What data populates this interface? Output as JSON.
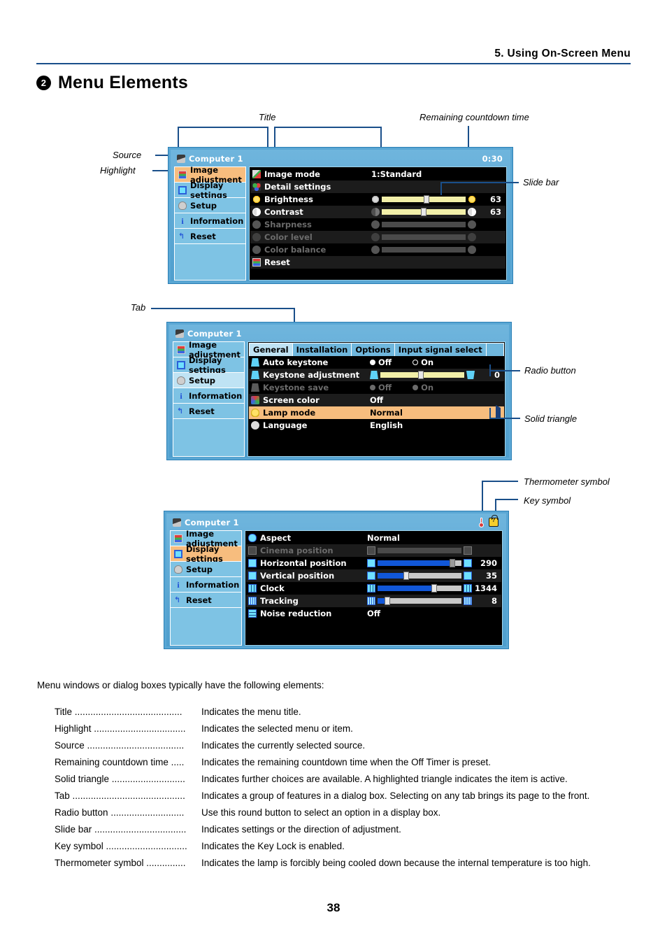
{
  "header": {
    "chapter": "5. Using On-Screen Menu",
    "section_number": "2",
    "section_title": "Menu Elements"
  },
  "callouts": {
    "title": "Title",
    "remaining": "Remaining countdown time",
    "source": "Source",
    "highlight": "Highlight",
    "slide_bar": "Slide bar",
    "tab": "Tab",
    "radio_button": "Radio button",
    "solid_triangle": "Solid triangle",
    "thermometer": "Thermometer symbol",
    "key_symbol": "Key symbol"
  },
  "osd_common": {
    "source_title": "Computer 1",
    "sidebar": [
      {
        "label": "Image adjustment",
        "icon": "grid-icon"
      },
      {
        "label": "Display settings",
        "icon": "screen-icon"
      },
      {
        "label": "Setup",
        "icon": "setup-icon"
      },
      {
        "label": "Information",
        "icon": "info-icon"
      },
      {
        "label": "Reset",
        "icon": "reset-icon"
      }
    ]
  },
  "osd1": {
    "title": "Computer 1",
    "countdown": "0:30",
    "selected_sidebar": 0,
    "rows": [
      {
        "label": "Image mode",
        "value": "1:Standard",
        "icon": "image-mode-icon",
        "type": "value",
        "dim": false
      },
      {
        "label": "Detail settings",
        "value": "",
        "icon": "detail-settings-icon",
        "type": "value",
        "dim": false
      },
      {
        "label": "Brightness",
        "value": "63",
        "icon": "brightness-icon",
        "type": "slider",
        "dim": false,
        "bar": "yellow",
        "pos": 50
      },
      {
        "label": "Contrast",
        "value": "63",
        "icon": "contrast-icon",
        "type": "slider",
        "dim": false,
        "bar": "yellow",
        "pos": 48
      },
      {
        "label": "Sharpness",
        "value": "",
        "icon": "sharpness-icon",
        "type": "slider",
        "dim": true,
        "bar": "gray",
        "pos": 0
      },
      {
        "label": "Color level",
        "value": "",
        "icon": "color-level-icon",
        "type": "slider",
        "dim": true,
        "bar": "gray",
        "pos": 0
      },
      {
        "label": "Color balance",
        "value": "",
        "icon": "color-balance-icon",
        "type": "slider",
        "dim": true,
        "bar": "gray",
        "pos": 0
      },
      {
        "label": "Reset",
        "value": "",
        "icon": "reset-multi-icon",
        "type": "value",
        "dim": false
      }
    ]
  },
  "osd2": {
    "title": "Computer 1",
    "selected_sidebar": 2,
    "tabs": [
      {
        "label": "General",
        "active": true
      },
      {
        "label": "Installation",
        "active": false
      },
      {
        "label": "Options",
        "active": false
      },
      {
        "label": "Input signal select",
        "active": false
      }
    ],
    "rows": [
      {
        "label": "Auto keystone",
        "icon": "auto-keystone-icon",
        "type": "radio",
        "dim": false,
        "options": [
          {
            "label": "Off",
            "selected": true
          },
          {
            "label": "On",
            "selected": false
          }
        ]
      },
      {
        "label": "Keystone adjustment",
        "icon": "keystone-icon",
        "type": "slider",
        "dim": false,
        "bar": "yellow",
        "pos": 45,
        "value": "0"
      },
      {
        "label": "Keystone save",
        "icon": "keystone-save-icon",
        "type": "radio",
        "dim": true,
        "options": [
          {
            "label": "Off",
            "selected": true
          },
          {
            "label": "On",
            "selected": false
          }
        ]
      },
      {
        "label": "Screen color",
        "icon": "screen-color-icon",
        "type": "value",
        "dim": false,
        "value": "Off"
      },
      {
        "label": "Lamp mode",
        "icon": "lamp-icon",
        "type": "value",
        "dim": false,
        "value": "Normal",
        "highlight": true,
        "triangle": true
      },
      {
        "label": "Language",
        "icon": "language-icon",
        "type": "value",
        "dim": false,
        "value": "English"
      }
    ]
  },
  "osd3": {
    "title": "Computer 1",
    "selected_sidebar": 1,
    "status_icons": [
      "thermometer-icon",
      "key-lock-icon"
    ],
    "rows": [
      {
        "label": "Aspect",
        "icon": "aspect-icon",
        "type": "value",
        "dim": false,
        "value": "Normal"
      },
      {
        "label": "Cinema position",
        "icon": "cinema-position-icon",
        "type": "slider",
        "dim": true,
        "bar": "gray",
        "pos": 0,
        "value": ""
      },
      {
        "label": "Horizontal position",
        "icon": "horizontal-position-icon",
        "type": "slider",
        "dim": false,
        "bar": "blue",
        "pos": 88,
        "value": "290"
      },
      {
        "label": "Vertical position",
        "icon": "vertical-position-icon",
        "type": "slider",
        "dim": false,
        "bar": "blue",
        "pos": 33,
        "value": "35"
      },
      {
        "label": "Clock",
        "icon": "clock-icon",
        "type": "slider",
        "dim": false,
        "bar": "blue",
        "pos": 66,
        "value": "1344"
      },
      {
        "label": "Tracking",
        "icon": "tracking-icon",
        "type": "slider",
        "dim": false,
        "bar": "blue",
        "pos": 9,
        "value": "8"
      },
      {
        "label": "Noise reduction",
        "icon": "noise-reduction-icon",
        "type": "value",
        "dim": false,
        "value": "Off"
      }
    ]
  },
  "body": {
    "intro": "Menu windows or dialog boxes typically have the following elements:",
    "definitions": [
      {
        "term": "Title",
        "dots": " .........................................",
        "desc": "Indicates the menu title."
      },
      {
        "term": "Highlight",
        "dots": " ...................................",
        "desc": "Indicates the selected menu or item."
      },
      {
        "term": "Source",
        "dots": " .....................................",
        "desc": "Indicates the currently selected source."
      },
      {
        "term": "Remaining countdown time",
        "dots": " .....",
        "desc": "Indicates the remaining countdown time when the Off Timer is preset."
      },
      {
        "term": "Solid triangle",
        "dots": " ............................",
        "desc": "Indicates further choices are available. A highlighted triangle indicates the item is active."
      },
      {
        "term": "Tab",
        "dots": " ...........................................",
        "desc": "Indicates a group of features in a dialog box. Selecting on any tab brings its page to the front."
      },
      {
        "term": "Radio button",
        "dots": " ............................",
        "desc": "Use this round button to select an option in a display box."
      },
      {
        "term": "Slide bar",
        "dots": " ...................................",
        "desc": "Indicates settings or the direction of adjustment."
      },
      {
        "term": "Key symbol",
        "dots": " ...............................",
        "desc": "Indicates the Key Lock is enabled."
      },
      {
        "term": "Thermometer symbol",
        "dots": " ...............",
        "desc": "Indicates the lamp is forcibly being cooled down because the internal temperature is too high."
      }
    ]
  },
  "page_number": "38"
}
